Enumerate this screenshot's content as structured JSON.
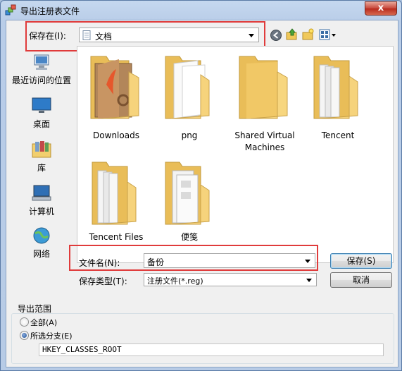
{
  "window": {
    "title": "导出注册表文件",
    "close_label": "x"
  },
  "save_in": {
    "label": "保存在(I):",
    "value": "文档"
  },
  "places": [
    {
      "label": "最近访问的位置",
      "icon": "recent-places-icon"
    },
    {
      "label": "桌面",
      "icon": "desktop-icon"
    },
    {
      "label": "库",
      "icon": "libraries-icon"
    },
    {
      "label": "计算机",
      "icon": "computer-icon"
    },
    {
      "label": "网络",
      "icon": "network-icon"
    }
  ],
  "files": [
    {
      "name": "Downloads",
      "icon": "downloads-folder-icon"
    },
    {
      "name": "png",
      "icon": "folder-icon"
    },
    {
      "name": "Shared Virtual Machines",
      "icon": "folder-icon"
    },
    {
      "name": "Tencent",
      "icon": "folder-icon"
    },
    {
      "name": "Tencent Files",
      "icon": "folder-icon"
    },
    {
      "name": "便笺",
      "icon": "folder-icon"
    }
  ],
  "filename": {
    "label": "文件名(N):",
    "value": "备份"
  },
  "filetype": {
    "label": "保存类型(T):",
    "value": "注册文件(*.reg)"
  },
  "buttons": {
    "save": "保存(S)",
    "cancel": "取消"
  },
  "export_range": {
    "label": "导出范围",
    "all_label": "全部(A)",
    "selected_label": "所选分支(E)",
    "selected": "selected",
    "branch": "HKEY_CLASSES_ROOT"
  },
  "colors": {
    "highlight_box": "#e03b3b",
    "folder": "#f3cf6b"
  }
}
